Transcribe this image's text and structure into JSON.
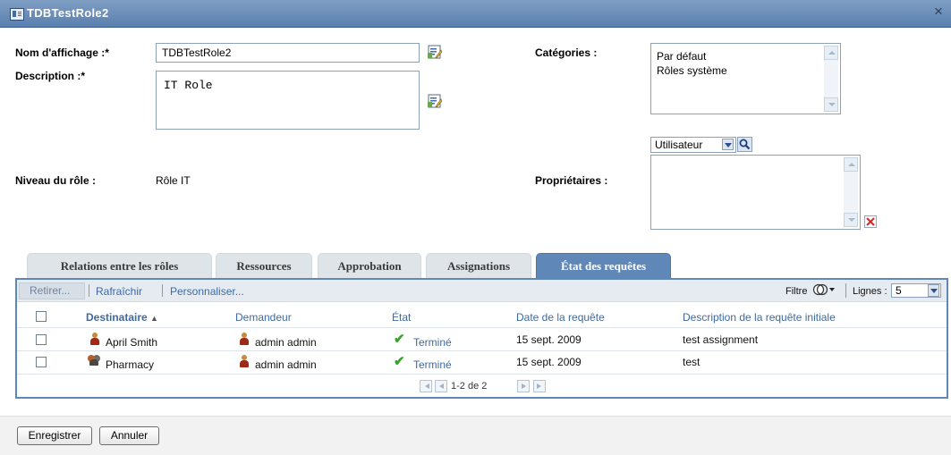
{
  "window": {
    "title": "TDBTestRole2",
    "close_glyph": "×"
  },
  "form": {
    "display_name_label": "Nom d'affichage :*",
    "display_name_value": "TDBTestRole2",
    "description_label": "Description :*",
    "description_value": "IT Role",
    "level_label": "Niveau du rôle :",
    "level_value": "Rôle IT",
    "categories_label": "Catégories :",
    "categories": [
      "Par défaut",
      "Rôles système"
    ],
    "owners_label": "Propriétaires :",
    "owner_type_value": "Utilisateur"
  },
  "tabs": [
    {
      "label": "Relations entre les rôles",
      "active": false
    },
    {
      "label": "Ressources",
      "active": false
    },
    {
      "label": "Approbation",
      "active": false
    },
    {
      "label": "Assignations",
      "active": false
    },
    {
      "label": "État des requêtes",
      "active": true
    }
  ],
  "toolbar": {
    "retract_label": "Retirer...",
    "refresh_label": "Rafraîchir",
    "customize_label": "Personnaliser...",
    "filter_label": "Filtre",
    "rows_label": "Lignes :",
    "rows_value": "5"
  },
  "table": {
    "columns": [
      "Destinataire",
      "Demandeur",
      "État",
      "Date de la requête",
      "Description de la requête initiale"
    ],
    "sort_indicator": "▲",
    "rows": [
      {
        "recipient": "April Smith",
        "recipient_type": "user",
        "requester": "admin admin",
        "status": "Terminé",
        "date": "15 sept. 2009",
        "description": "test assignment"
      },
      {
        "recipient": "Pharmacy",
        "recipient_type": "group",
        "requester": "admin admin",
        "status": "Terminé",
        "date": "15 sept. 2009",
        "description": "test"
      }
    ],
    "pagination": "1-2 de 2"
  },
  "footer": {
    "save_label": "Enregistrer",
    "cancel_label": "Annuler"
  },
  "colors": {
    "accent": "#5f88b9",
    "link": "#3d6aa3",
    "success": "#35a32a",
    "delete": "#d42a2a"
  }
}
